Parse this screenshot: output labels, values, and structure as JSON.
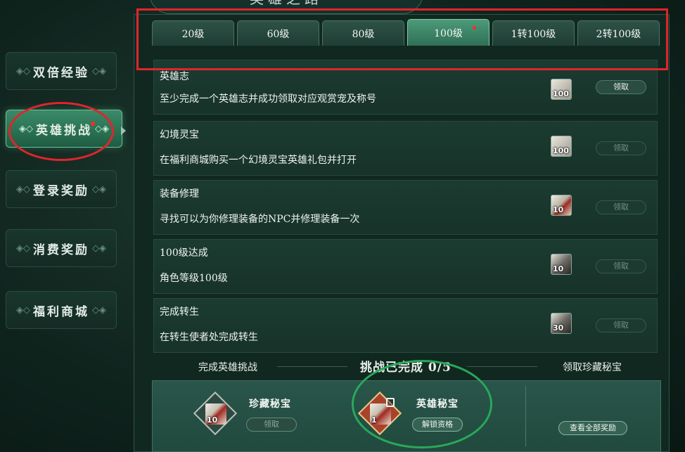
{
  "window": {
    "title": "英雄之路"
  },
  "sidebar": {
    "items": [
      {
        "label": "双倍经验",
        "active": false
      },
      {
        "label": "英雄挑战",
        "active": true,
        "has_notification": true
      },
      {
        "label": "登录奖励",
        "active": false
      },
      {
        "label": "消费奖励",
        "active": false
      },
      {
        "label": "福利商城",
        "active": false
      }
    ]
  },
  "tabs": [
    {
      "label": "20级",
      "active": false
    },
    {
      "label": "60级",
      "active": false
    },
    {
      "label": "80级",
      "active": false
    },
    {
      "label": "100级",
      "active": true,
      "has_notification": true
    },
    {
      "label": "1转100级",
      "active": false
    },
    {
      "label": "2转100级",
      "active": false
    }
  ],
  "tasks": [
    {
      "title": "英雄志",
      "description": "至少完成一个英雄志并成功领取对应观赏宠及称号",
      "icon": "silver-coin-icon",
      "reward_count": "100",
      "button": "领取",
      "button_enabled": true
    },
    {
      "title": "幻境灵宝",
      "description": "在福利商城购买一个幻境灵宝英雄礼包并打开",
      "icon": "silver-coin-icon",
      "reward_count": "100",
      "button": "领取",
      "button_enabled": false
    },
    {
      "title": "装备修理",
      "description": "寻找可以为你修理装备的NPC并修理装备一次",
      "icon": "red-scroll-icon",
      "reward_count": "10",
      "button": "领取",
      "button_enabled": false
    },
    {
      "title": "100级达成",
      "description": "角色等级100级",
      "icon": "axe-icon",
      "reward_count": "10",
      "button": "领取",
      "button_enabled": false
    },
    {
      "title": "完成转生",
      "description": "在转生使者处完成转生",
      "icon": "horn-icon",
      "reward_count": "30",
      "button": "领取",
      "button_enabled": false
    }
  ],
  "bottom": {
    "left_header": "完成英雄挑战",
    "progress": "挑战已完成 0/5",
    "right_header": "领取珍藏秘宝",
    "reward1": {
      "name": "珍藏秘宝",
      "badge": "10",
      "button": "领取",
      "button_enabled": false
    },
    "reward2": {
      "name": "英雄秘宝",
      "badge": "1",
      "button": "解锁资格",
      "locked": true
    },
    "view_all_button": "查看全部奖励"
  },
  "annotations": {
    "red": "#e0252b",
    "green": "#29a85a",
    "notification_dot": "#ff2a2a"
  }
}
